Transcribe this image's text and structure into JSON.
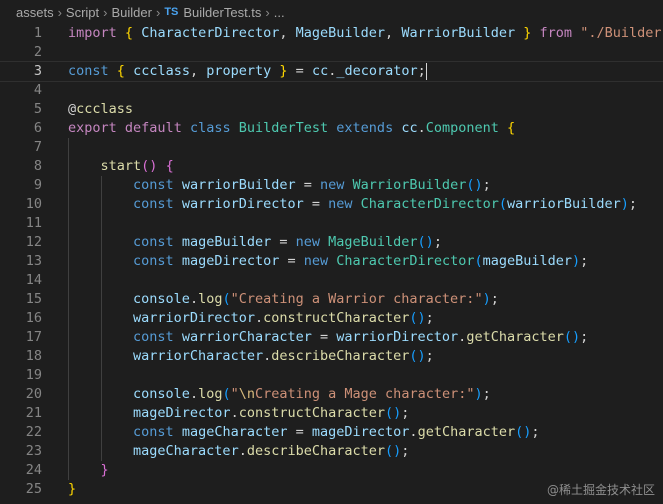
{
  "breadcrumb": {
    "items": [
      "assets",
      "Script",
      "Builder"
    ],
    "file_badge": "TS",
    "file_name": "BuilderTest.ts",
    "more": "..."
  },
  "editor": {
    "current_line": 3,
    "lines": [
      {
        "n": "1",
        "tokens": [
          [
            "kc",
            "import"
          ],
          [
            "pl",
            " "
          ],
          [
            "p1",
            "{"
          ],
          [
            "pl",
            " "
          ],
          [
            "var",
            "CharacterDirector"
          ],
          [
            "pl",
            ", "
          ],
          [
            "var",
            "MageBuilder"
          ],
          [
            "pl",
            ", "
          ],
          [
            "var",
            "WarriorBuilder"
          ],
          [
            "pl",
            " "
          ],
          [
            "p1",
            "}"
          ],
          [
            "pl",
            " "
          ],
          [
            "kc",
            "from"
          ],
          [
            "pl",
            " "
          ],
          [
            "str",
            "\"./Builder\""
          ],
          [
            "pl",
            ";"
          ]
        ]
      },
      {
        "n": "2",
        "tokens": []
      },
      {
        "n": "3",
        "tokens": [
          [
            "kw",
            "const"
          ],
          [
            "pl",
            " "
          ],
          [
            "p1",
            "{"
          ],
          [
            "pl",
            " "
          ],
          [
            "var",
            "ccclass"
          ],
          [
            "pl",
            ", "
          ],
          [
            "var",
            "property"
          ],
          [
            "pl",
            " "
          ],
          [
            "p1",
            "}"
          ],
          [
            "pl",
            " = "
          ],
          [
            "var",
            "cc"
          ],
          [
            "pl",
            "."
          ],
          [
            "var",
            "_decorator"
          ],
          [
            "pl",
            ";"
          ]
        ]
      },
      {
        "n": "4",
        "tokens": []
      },
      {
        "n": "5",
        "tokens": [
          [
            "pl",
            "@"
          ],
          [
            "fn",
            "ccclass"
          ]
        ]
      },
      {
        "n": "6",
        "tokens": [
          [
            "kc",
            "export"
          ],
          [
            "pl",
            " "
          ],
          [
            "kc",
            "default"
          ],
          [
            "pl",
            " "
          ],
          [
            "kw",
            "class"
          ],
          [
            "pl",
            " "
          ],
          [
            "cls",
            "BuilderTest"
          ],
          [
            "pl",
            " "
          ],
          [
            "kw",
            "extends"
          ],
          [
            "pl",
            " "
          ],
          [
            "var",
            "cc"
          ],
          [
            "pl",
            "."
          ],
          [
            "cls",
            "Component"
          ],
          [
            "pl",
            " "
          ],
          [
            "p1",
            "{"
          ]
        ]
      },
      {
        "n": "7",
        "tokens": []
      },
      {
        "n": "8",
        "tokens": [
          [
            "pl",
            "    "
          ],
          [
            "fn",
            "start"
          ],
          [
            "p2",
            "()"
          ],
          [
            "pl",
            " "
          ],
          [
            "p2",
            "{"
          ]
        ]
      },
      {
        "n": "9",
        "tokens": [
          [
            "pl",
            "        "
          ],
          [
            "kw",
            "const"
          ],
          [
            "pl",
            " "
          ],
          [
            "var",
            "warriorBuilder"
          ],
          [
            "pl",
            " = "
          ],
          [
            "kw",
            "new"
          ],
          [
            "pl",
            " "
          ],
          [
            "cls",
            "WarriorBuilder"
          ],
          [
            "p3",
            "()"
          ],
          [
            "pl",
            ";"
          ]
        ]
      },
      {
        "n": "10",
        "tokens": [
          [
            "pl",
            "        "
          ],
          [
            "kw",
            "const"
          ],
          [
            "pl",
            " "
          ],
          [
            "var",
            "warriorDirector"
          ],
          [
            "pl",
            " = "
          ],
          [
            "kw",
            "new"
          ],
          [
            "pl",
            " "
          ],
          [
            "cls",
            "CharacterDirector"
          ],
          [
            "p3",
            "("
          ],
          [
            "var",
            "warriorBuilder"
          ],
          [
            "p3",
            ")"
          ],
          [
            "pl",
            ";"
          ]
        ]
      },
      {
        "n": "11",
        "tokens": []
      },
      {
        "n": "12",
        "tokens": [
          [
            "pl",
            "        "
          ],
          [
            "kw",
            "const"
          ],
          [
            "pl",
            " "
          ],
          [
            "var",
            "mageBuilder"
          ],
          [
            "pl",
            " = "
          ],
          [
            "kw",
            "new"
          ],
          [
            "pl",
            " "
          ],
          [
            "cls",
            "MageBuilder"
          ],
          [
            "p3",
            "()"
          ],
          [
            "pl",
            ";"
          ]
        ]
      },
      {
        "n": "13",
        "tokens": [
          [
            "pl",
            "        "
          ],
          [
            "kw",
            "const"
          ],
          [
            "pl",
            " "
          ],
          [
            "var",
            "mageDirector"
          ],
          [
            "pl",
            " = "
          ],
          [
            "kw",
            "new"
          ],
          [
            "pl",
            " "
          ],
          [
            "cls",
            "CharacterDirector"
          ],
          [
            "p3",
            "("
          ],
          [
            "var",
            "mageBuilder"
          ],
          [
            "p3",
            ")"
          ],
          [
            "pl",
            ";"
          ]
        ]
      },
      {
        "n": "14",
        "tokens": []
      },
      {
        "n": "15",
        "tokens": [
          [
            "pl",
            "        "
          ],
          [
            "var",
            "console"
          ],
          [
            "pl",
            "."
          ],
          [
            "fn",
            "log"
          ],
          [
            "p3",
            "("
          ],
          [
            "str",
            "\"Creating a Warrior character:\""
          ],
          [
            "p3",
            ")"
          ],
          [
            "pl",
            ";"
          ]
        ]
      },
      {
        "n": "16",
        "tokens": [
          [
            "pl",
            "        "
          ],
          [
            "var",
            "warriorDirector"
          ],
          [
            "pl",
            "."
          ],
          [
            "fn",
            "constructCharacter"
          ],
          [
            "p3",
            "()"
          ],
          [
            "pl",
            ";"
          ]
        ]
      },
      {
        "n": "17",
        "tokens": [
          [
            "pl",
            "        "
          ],
          [
            "kw",
            "const"
          ],
          [
            "pl",
            " "
          ],
          [
            "var",
            "warriorCharacter"
          ],
          [
            "pl",
            " = "
          ],
          [
            "var",
            "warriorDirector"
          ],
          [
            "pl",
            "."
          ],
          [
            "fn",
            "getCharacter"
          ],
          [
            "p3",
            "()"
          ],
          [
            "pl",
            ";"
          ]
        ]
      },
      {
        "n": "18",
        "tokens": [
          [
            "pl",
            "        "
          ],
          [
            "var",
            "warriorCharacter"
          ],
          [
            "pl",
            "."
          ],
          [
            "fn",
            "describeCharacter"
          ],
          [
            "p3",
            "()"
          ],
          [
            "pl",
            ";"
          ]
        ]
      },
      {
        "n": "19",
        "tokens": []
      },
      {
        "n": "20",
        "tokens": [
          [
            "pl",
            "        "
          ],
          [
            "var",
            "console"
          ],
          [
            "pl",
            "."
          ],
          [
            "fn",
            "log"
          ],
          [
            "p3",
            "("
          ],
          [
            "str",
            "\""
          ],
          [
            "esc",
            "\\n"
          ],
          [
            "str",
            "Creating a Mage character:\""
          ],
          [
            "p3",
            ")"
          ],
          [
            "pl",
            ";"
          ]
        ]
      },
      {
        "n": "21",
        "tokens": [
          [
            "pl",
            "        "
          ],
          [
            "var",
            "mageDirector"
          ],
          [
            "pl",
            "."
          ],
          [
            "fn",
            "constructCharacter"
          ],
          [
            "p3",
            "()"
          ],
          [
            "pl",
            ";"
          ]
        ]
      },
      {
        "n": "22",
        "tokens": [
          [
            "pl",
            "        "
          ],
          [
            "kw",
            "const"
          ],
          [
            "pl",
            " "
          ],
          [
            "var",
            "mageCharacter"
          ],
          [
            "pl",
            " = "
          ],
          [
            "var",
            "mageDirector"
          ],
          [
            "pl",
            "."
          ],
          [
            "fn",
            "getCharacter"
          ],
          [
            "p3",
            "()"
          ],
          [
            "pl",
            ";"
          ]
        ]
      },
      {
        "n": "23",
        "tokens": [
          [
            "pl",
            "        "
          ],
          [
            "var",
            "mageCharacter"
          ],
          [
            "pl",
            "."
          ],
          [
            "fn",
            "describeCharacter"
          ],
          [
            "p3",
            "()"
          ],
          [
            "pl",
            ";"
          ]
        ]
      },
      {
        "n": "24",
        "tokens": [
          [
            "pl",
            "    "
          ],
          [
            "p2",
            "}"
          ]
        ]
      },
      {
        "n": "25",
        "tokens": [
          [
            "p1",
            "}"
          ]
        ]
      }
    ]
  },
  "watermark": "@稀土掘金技术社区"
}
